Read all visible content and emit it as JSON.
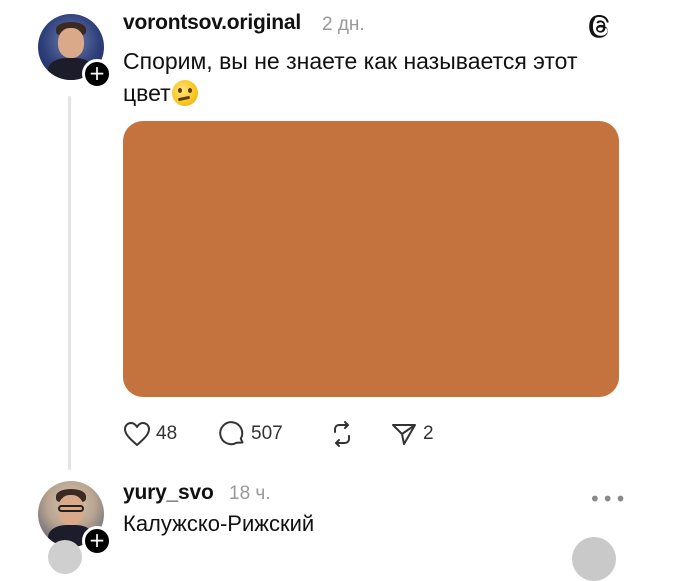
{
  "post": {
    "username": "vorontsov.original",
    "time": "2 дн.",
    "text": "Спорим, вы не знаете как называется этот цвет",
    "image_color": "#C4733F",
    "actions": {
      "likes": "48",
      "comments": "507",
      "shares": "2"
    }
  },
  "reply": {
    "username": "yury_svo",
    "time": "18 ч.",
    "text": "Калужско-Рижский"
  },
  "icons": [
    "threads-logo-icon",
    "heart-icon",
    "comment-icon",
    "repost-icon",
    "share-icon",
    "more-icon",
    "plus-icon",
    "thinking-face-emoji"
  ],
  "colors": {
    "swatch": "#C4733F",
    "thread_line": "#E4E4E4",
    "muted": "#999999"
  }
}
